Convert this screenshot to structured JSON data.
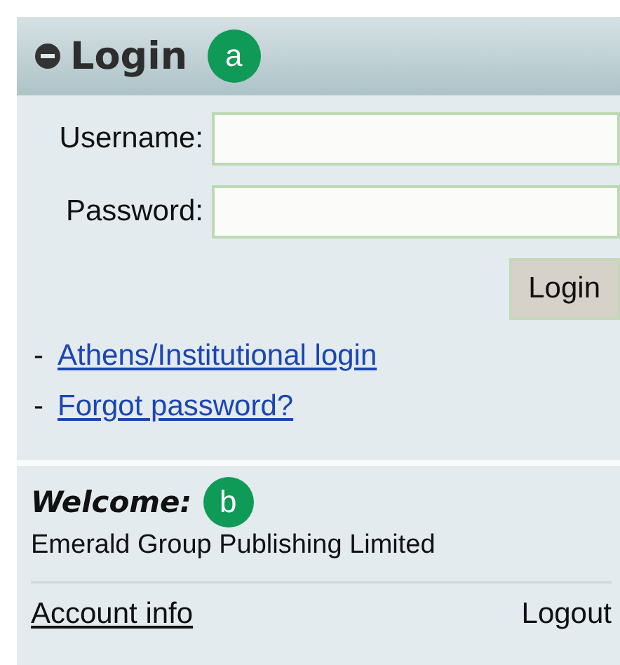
{
  "login_panel": {
    "title": "Login",
    "title_marker": "a",
    "fields": [
      {
        "label": "Username:"
      },
      {
        "label": "Password:"
      }
    ],
    "submit": "Login",
    "links": [
      {
        "bullet": "-",
        "label": "Athens/Institutional login"
      },
      {
        "bullet": "-",
        "label": "Forgot password?"
      }
    ]
  },
  "welcome_panel": {
    "heading": "Welcome:",
    "heading_marker": "b",
    "organization": "Emerald Group Publishing Limited",
    "account_link": "Account info",
    "logout": "Logout"
  }
}
